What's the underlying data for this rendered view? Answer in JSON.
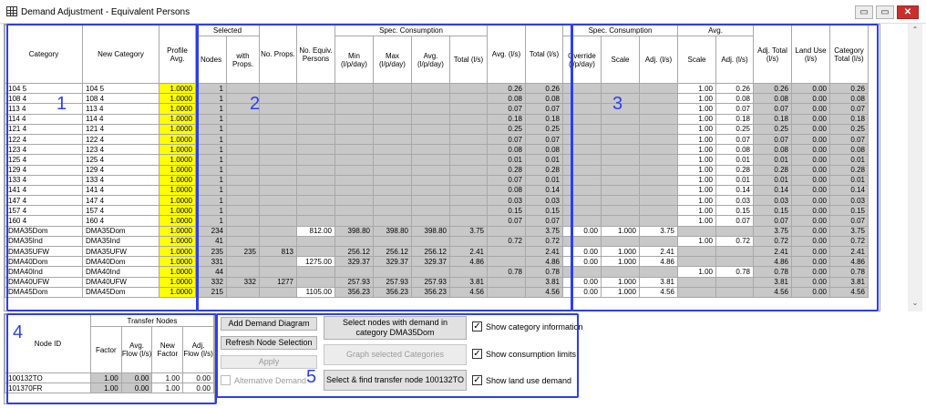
{
  "window": {
    "title": "Demand Adjustment - Equivalent Persons",
    "min": "▭",
    "restore": "▭",
    "close": "✕"
  },
  "grid_headers": {
    "category": "Category",
    "new_category": "New Category",
    "profile_avg": "Profile Avg.",
    "selected": "Selected",
    "nodes": "Nodes",
    "with_props": "with Props.",
    "no_props": "No. Props.",
    "no_equiv_persons": "No. Equiv. Persons",
    "spec_consumption": "Spec. Consumption",
    "min": "Min (l/p/day)",
    "max": "Max (l/p/day)",
    "avg": "Avg. (l/p/day)",
    "total": "Total (l/s)",
    "avg_ls": "Avg. (l/s)",
    "total_ls": "Total (l/s)",
    "spec_consumption2": "Spec. Consumption",
    "override": "Override (l/p/day)",
    "scale": "Scale",
    "adj": "Adj. (l/s)",
    "avg_group": "Avg.",
    "avg_scale": "Scale",
    "avg_adj": "Adj. (l/s)",
    "adj_total": "Adj. Total (l/s)",
    "land_use": "Land Use (l/s)",
    "category_total": "Category Total (l/s)"
  },
  "rows": [
    {
      "cat": "104   5",
      "newcat": "104   5",
      "prof": "1.0000",
      "nodes": "1",
      "withp": "",
      "nop": "",
      "equiv": "",
      "min": "",
      "max": "",
      "savg": "",
      "stot": "",
      "avg": "0.26",
      "tot": "0.26",
      "ovr": "",
      "sscale": "",
      "sadj": "",
      "ascale": "1.00",
      "aadj": "0.26",
      "adjt": "0.26",
      "land": "0.00",
      "cattot": "0.26"
    },
    {
      "cat": "108   4",
      "newcat": "108   4",
      "prof": "1.0000",
      "nodes": "1",
      "withp": "",
      "nop": "",
      "equiv": "",
      "min": "",
      "max": "",
      "savg": "",
      "stot": "",
      "avg": "0.08",
      "tot": "0.08",
      "ovr": "",
      "sscale": "",
      "sadj": "",
      "ascale": "1.00",
      "aadj": "0.08",
      "adjt": "0.08",
      "land": "0.00",
      "cattot": "0.08"
    },
    {
      "cat": "113   4",
      "newcat": "113   4",
      "prof": "1.0000",
      "nodes": "1",
      "withp": "",
      "nop": "",
      "equiv": "",
      "min": "",
      "max": "",
      "savg": "",
      "stot": "",
      "avg": "0.07",
      "tot": "0.07",
      "ovr": "",
      "sscale": "",
      "sadj": "",
      "ascale": "1.00",
      "aadj": "0.07",
      "adjt": "0.07",
      "land": "0.00",
      "cattot": "0.07"
    },
    {
      "cat": "114   4",
      "newcat": "114   4",
      "prof": "1.0000",
      "nodes": "1",
      "withp": "",
      "nop": "",
      "equiv": "",
      "min": "",
      "max": "",
      "savg": "",
      "stot": "",
      "avg": "0.18",
      "tot": "0.18",
      "ovr": "",
      "sscale": "",
      "sadj": "",
      "ascale": "1.00",
      "aadj": "0.18",
      "adjt": "0.18",
      "land": "0.00",
      "cattot": "0.18"
    },
    {
      "cat": "121   4",
      "newcat": "121   4",
      "prof": "1.0000",
      "nodes": "1",
      "withp": "",
      "nop": "",
      "equiv": "",
      "min": "",
      "max": "",
      "savg": "",
      "stot": "",
      "avg": "0.25",
      "tot": "0.25",
      "ovr": "",
      "sscale": "",
      "sadj": "",
      "ascale": "1.00",
      "aadj": "0.25",
      "adjt": "0.25",
      "land": "0.00",
      "cattot": "0.25"
    },
    {
      "cat": "122   4",
      "newcat": "122   4",
      "prof": "1.0000",
      "nodes": "1",
      "withp": "",
      "nop": "",
      "equiv": "",
      "min": "",
      "max": "",
      "savg": "",
      "stot": "",
      "avg": "0.07",
      "tot": "0.07",
      "ovr": "",
      "sscale": "",
      "sadj": "",
      "ascale": "1.00",
      "aadj": "0.07",
      "adjt": "0.07",
      "land": "0.00",
      "cattot": "0.07"
    },
    {
      "cat": "123   4",
      "newcat": "123   4",
      "prof": "1.0000",
      "nodes": "1",
      "withp": "",
      "nop": "",
      "equiv": "",
      "min": "",
      "max": "",
      "savg": "",
      "stot": "",
      "avg": "0.08",
      "tot": "0.08",
      "ovr": "",
      "sscale": "",
      "sadj": "",
      "ascale": "1.00",
      "aadj": "0.08",
      "adjt": "0.08",
      "land": "0.00",
      "cattot": "0.08"
    },
    {
      "cat": "125   4",
      "newcat": "125   4",
      "prof": "1.0000",
      "nodes": "1",
      "withp": "",
      "nop": "",
      "equiv": "",
      "min": "",
      "max": "",
      "savg": "",
      "stot": "",
      "avg": "0.01",
      "tot": "0.01",
      "ovr": "",
      "sscale": "",
      "sadj": "",
      "ascale": "1.00",
      "aadj": "0.01",
      "adjt": "0.01",
      "land": "0.00",
      "cattot": "0.01"
    },
    {
      "cat": "129   4",
      "newcat": "129   4",
      "prof": "1.0000",
      "nodes": "1",
      "withp": "",
      "nop": "",
      "equiv": "",
      "min": "",
      "max": "",
      "savg": "",
      "stot": "",
      "avg": "0.28",
      "tot": "0.28",
      "ovr": "",
      "sscale": "",
      "sadj": "",
      "ascale": "1.00",
      "aadj": "0.28",
      "adjt": "0.28",
      "land": "0.00",
      "cattot": "0.28"
    },
    {
      "cat": "133   4",
      "newcat": "133   4",
      "prof": "1.0000",
      "nodes": "1",
      "withp": "",
      "nop": "",
      "equiv": "",
      "min": "",
      "max": "",
      "savg": "",
      "stot": "",
      "avg": "0.07",
      "tot": "0.01",
      "ovr": "",
      "sscale": "",
      "sadj": "",
      "ascale": "1.00",
      "aadj": "0.01",
      "adjt": "0.01",
      "land": "0.00",
      "cattot": "0.01"
    },
    {
      "cat": "141   4",
      "newcat": "141   4",
      "prof": "1.0000",
      "nodes": "1",
      "withp": "",
      "nop": "",
      "equiv": "",
      "min": "",
      "max": "",
      "savg": "",
      "stot": "",
      "avg": "0.08",
      "tot": "0.14",
      "ovr": "",
      "sscale": "",
      "sadj": "",
      "ascale": "1.00",
      "aadj": "0.14",
      "adjt": "0.14",
      "land": "0.00",
      "cattot": "0.14"
    },
    {
      "cat": "147   4",
      "newcat": "147   4",
      "prof": "1.0000",
      "nodes": "1",
      "withp": "",
      "nop": "",
      "equiv": "",
      "min": "",
      "max": "",
      "savg": "",
      "stot": "",
      "avg": "0.03",
      "tot": "0.03",
      "ovr": "",
      "sscale": "",
      "sadj": "",
      "ascale": "1.00",
      "aadj": "0.03",
      "adjt": "0.03",
      "land": "0.00",
      "cattot": "0.03"
    },
    {
      "cat": "157   4",
      "newcat": "157   4",
      "prof": "1.0000",
      "nodes": "1",
      "withp": "",
      "nop": "",
      "equiv": "",
      "min": "",
      "max": "",
      "savg": "",
      "stot": "",
      "avg": "0.15",
      "tot": "0.15",
      "ovr": "",
      "sscale": "",
      "sadj": "",
      "ascale": "1.00",
      "aadj": "0.15",
      "adjt": "0.15",
      "land": "0.00",
      "cattot": "0.15"
    },
    {
      "cat": "160   4",
      "newcat": "160   4",
      "prof": "1.0000",
      "nodes": "1",
      "withp": "",
      "nop": "",
      "equiv": "",
      "min": "",
      "max": "",
      "savg": "",
      "stot": "",
      "avg": "0.07",
      "tot": "0.07",
      "ovr": "",
      "sscale": "",
      "sadj": "",
      "ascale": "1.00",
      "aadj": "0.07",
      "adjt": "0.07",
      "land": "0.00",
      "cattot": "0.07"
    },
    {
      "cat": "DMA35Dom",
      "newcat": "DMA35Dom",
      "prof": "1.0000",
      "nodes": "234",
      "withp": "",
      "nop": "",
      "equiv": "812.00",
      "min": "398.80",
      "max": "398.80",
      "savg": "398.80",
      "stot": "3.75",
      "avg": "",
      "tot": "3.75",
      "ovr": "0.00",
      "sscale": "1.000",
      "sadj": "3.75",
      "ascale": "",
      "aadj": "",
      "adjt": "3.75",
      "land": "0.00",
      "cattot": "3.75"
    },
    {
      "cat": "DMA35Ind",
      "newcat": "DMA35Ind",
      "prof": "1.0000",
      "nodes": "41",
      "withp": "",
      "nop": "",
      "equiv": "",
      "min": "",
      "max": "",
      "savg": "",
      "stot": "",
      "avg": "0.72",
      "tot": "0.72",
      "ovr": "",
      "sscale": "",
      "sadj": "",
      "ascale": "1.00",
      "aadj": "0.72",
      "adjt": "0.72",
      "land": "0.00",
      "cattot": "0.72"
    },
    {
      "cat": "DMA35UFW",
      "newcat": "DMA35UFW",
      "prof": "1.0000",
      "nodes": "235",
      "withp": "235",
      "nop": "813",
      "equiv": "",
      "min": "256.12",
      "max": "256.12",
      "savg": "256.12",
      "stot": "2.41",
      "avg": "",
      "tot": "2.41",
      "ovr": "0.00",
      "sscale": "1.000",
      "sadj": "2.41",
      "ascale": "",
      "aadj": "",
      "adjt": "2.41",
      "land": "0.00",
      "cattot": "2.41"
    },
    {
      "cat": "DMA40Dom",
      "newcat": "DMA40Dom",
      "prof": "1.0000",
      "nodes": "331",
      "withp": "",
      "nop": "",
      "equiv": "1275.00",
      "min": "329.37",
      "max": "329.37",
      "savg": "329.37",
      "stot": "4.86",
      "avg": "",
      "tot": "4.86",
      "ovr": "0.00",
      "sscale": "1.000",
      "sadj": "4.86",
      "ascale": "",
      "aadj": "",
      "adjt": "4.86",
      "land": "0.00",
      "cattot": "4.86"
    },
    {
      "cat": "DMA40Ind",
      "newcat": "DMA40Ind",
      "prof": "1.0000",
      "nodes": "44",
      "withp": "",
      "nop": "",
      "equiv": "",
      "min": "",
      "max": "",
      "savg": "",
      "stot": "",
      "avg": "0.78",
      "tot": "0.78",
      "ovr": "",
      "sscale": "",
      "sadj": "",
      "ascale": "1.00",
      "aadj": "0.78",
      "adjt": "0.78",
      "land": "0.00",
      "cattot": "0.78"
    },
    {
      "cat": "DMA40UFW",
      "newcat": "DMA40UFW",
      "prof": "1.0000",
      "nodes": "332",
      "withp": "332",
      "nop": "1277",
      "equiv": "",
      "min": "257.93",
      "max": "257.93",
      "savg": "257.93",
      "stot": "3.81",
      "avg": "",
      "tot": "3.81",
      "ovr": "0.00",
      "sscale": "1.000",
      "sadj": "3.81",
      "ascale": "",
      "aadj": "",
      "adjt": "3.81",
      "land": "0.00",
      "cattot": "3.81"
    },
    {
      "cat": "DMA45Dom",
      "newcat": "DMA45Dom",
      "prof": "1.0000",
      "nodes": "215",
      "withp": "",
      "nop": "",
      "equiv": "1105.00",
      "min": "356.23",
      "max": "356.23",
      "savg": "356.23",
      "stot": "4.56",
      "avg": "",
      "tot": "4.56",
      "ovr": "0.00",
      "sscale": "1.000",
      "sadj": "4.56",
      "ascale": "",
      "aadj": "",
      "adjt": "4.56",
      "land": "0.00",
      "cattot": "4.56"
    }
  ],
  "transfer": {
    "headers": {
      "node_id": "Node ID",
      "group": "Transfer Nodes",
      "factor": "Factor",
      "avg_flow": "Avg. Flow (l/s)",
      "new_factor": "New Factor",
      "adj_flow": "Adj. Flow (l/s)"
    },
    "rows": [
      {
        "id": "100132TO",
        "factor": "1.00",
        "avg": "0.00",
        "newf": "1.00",
        "adj": "0.00"
      },
      {
        "id": "101370FR",
        "factor": "1.00",
        "avg": "0.00",
        "newf": "1.00",
        "adj": "0.00"
      }
    ]
  },
  "buttons": {
    "add_diagram": "Add Demand Diagram",
    "refresh": "Refresh Node Selection",
    "apply": "Apply",
    "select_nodes": "Select nodes with demand in category DMA35Dom",
    "graph": "Graph selected Categories",
    "select_find": "Select & find transfer node 100132TO"
  },
  "checkboxes": {
    "alt_demand": "Alternative Demand",
    "show_cat": "Show category information",
    "show_cons": "Show consumption limits",
    "show_land": "Show land use demand",
    "check": "✓"
  },
  "annotations": {
    "n1": "1",
    "n2": "2",
    "n3": "3",
    "n4": "4",
    "n5": "5"
  },
  "scroll": {
    "up": "⌃",
    "down": "⌄"
  }
}
